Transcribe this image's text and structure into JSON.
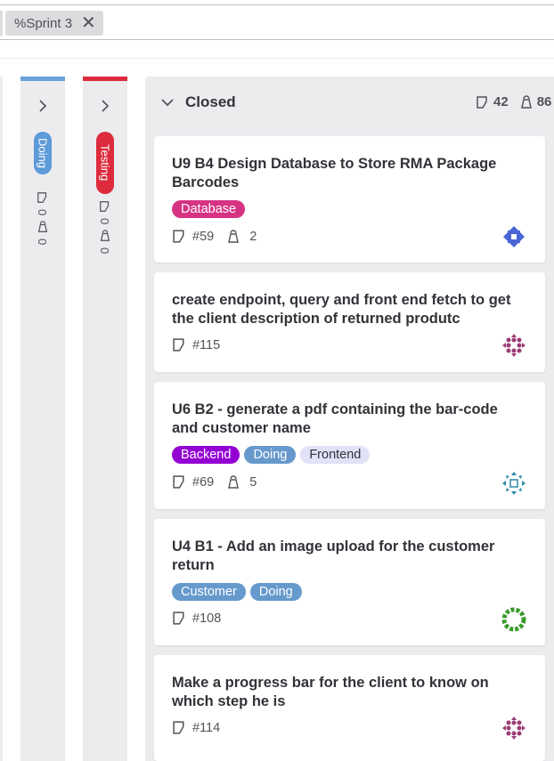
{
  "filter": {
    "token_label": "%Sprint 3",
    "close_glyph": "✕"
  },
  "columns": {
    "doing": {
      "label": "Doing",
      "color": "#5c9ad8",
      "issues": "0",
      "weight": "0"
    },
    "testing": {
      "label": "Testing",
      "color": "#dd2b3e",
      "issues": "0",
      "weight": "0"
    },
    "closed": {
      "label": "Closed",
      "issues": "42",
      "weight": "86"
    }
  },
  "cards": [
    {
      "title": "U9 B4 Design Database to Store RMA Package Barcodes",
      "labels": [
        {
          "text": "Database",
          "bg": "#d63384"
        }
      ],
      "ref": "#59",
      "weight": "2",
      "avatar": "blue"
    },
    {
      "title": "create endpoint, query and front end fetch to get the client description of returned produtc",
      "labels": [],
      "ref": "#115",
      "weight": "",
      "avatar": "purple"
    },
    {
      "title": "U6 B2 - generate a pdf containing the bar-code and customer name",
      "labels": [
        {
          "text": "Backend",
          "bg": "#9400d3"
        },
        {
          "text": "Doing",
          "bg": "#6699cc"
        },
        {
          "text": "Frontend",
          "bg": "#e1e1f7"
        }
      ],
      "ref": "#69",
      "weight": "5",
      "avatar": "teal"
    },
    {
      "title": "U4 B1 - Add an image upload for the customer return",
      "labels": [
        {
          "text": "Customer",
          "bg": "#6699cc"
        },
        {
          "text": "Doing",
          "bg": "#6699cc"
        }
      ],
      "ref": "#108",
      "weight": "",
      "avatar": "green"
    },
    {
      "title": "Make a progress bar for the client to know on which step he is",
      "labels": [],
      "ref": "#114",
      "weight": "",
      "avatar": "purple"
    }
  ],
  "icons": {
    "issue": "issue-icon",
    "weight": "weight-icon",
    "chevron_right": "chevron-right-icon",
    "chevron_down": "chevron-down-icon",
    "close": "close-icon"
  }
}
